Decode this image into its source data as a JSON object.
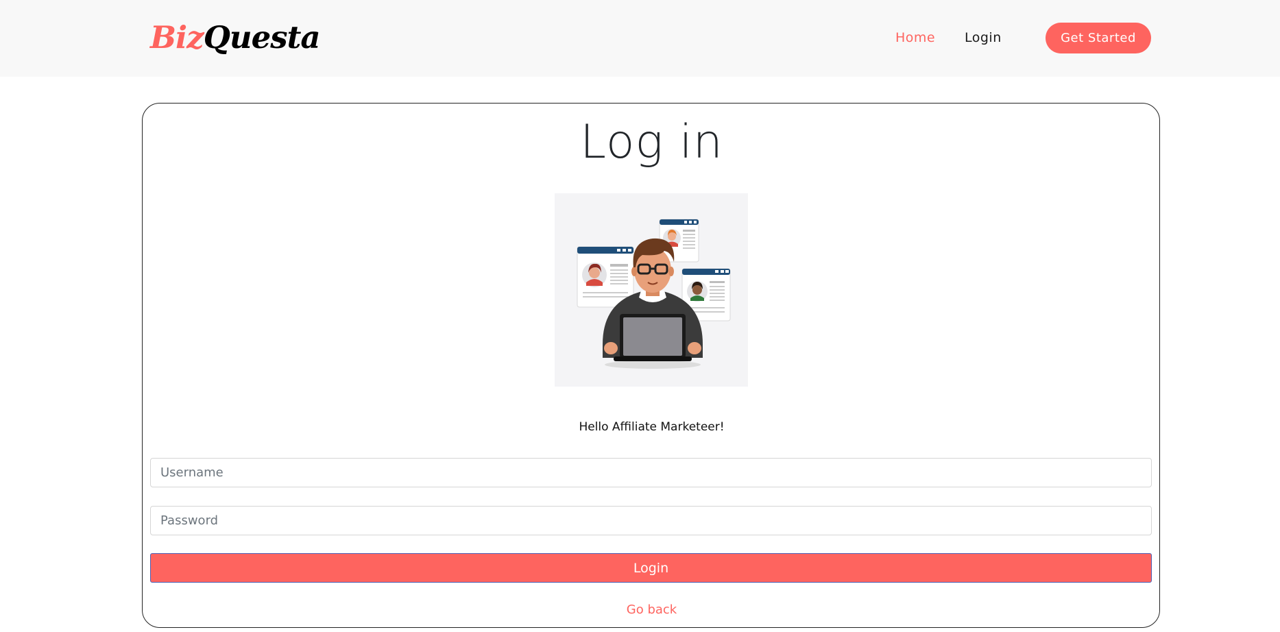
{
  "header": {
    "logo_part1": "Biz",
    "logo_part2": "Questa",
    "nav": {
      "home_label": "Home",
      "login_label": "Login"
    },
    "cta_label": "Get Started"
  },
  "login_card": {
    "title": "Log in",
    "illustration_icon": "user-at-laptop-with-profiles-icon",
    "greeting": "Hello Affiliate Marketeer!",
    "username_placeholder": "Username",
    "password_placeholder": "Password",
    "submit_label": "Login",
    "back_label": "Go back"
  },
  "colors": {
    "accent": "#fe645f",
    "header_bg": "#f8f8f8",
    "text_dark": "#212529"
  }
}
